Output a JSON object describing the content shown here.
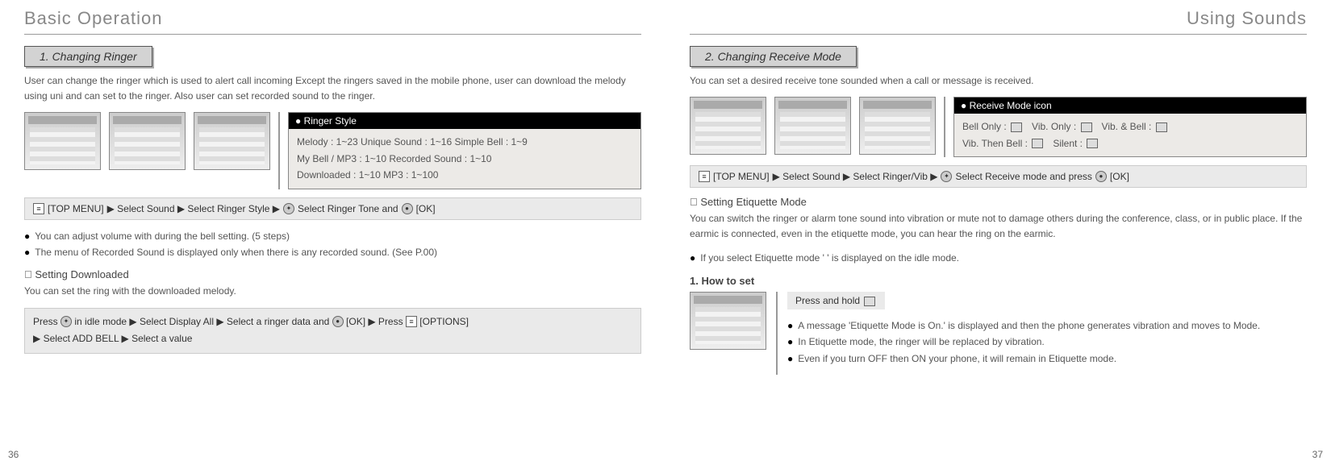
{
  "left": {
    "page_title": "Basic Operation",
    "page_number": "36",
    "section_heading": "1. Changing Ringer",
    "intro": "User can change the ringer which is used to alert call incoming Except the ringers saved in the mobile phone, user can download the melody using uni and can set to the ringer. Also user can set recorded sound to the ringer.",
    "ringer_style_header": "● Ringer Style",
    "ringer_style_lines": [
      "Melody : 1~23   Unique Sound : 1~16   Simple Bell : 1~9",
      "My Bell / MP3 : 1~10   Recorded Sound : 1~10",
      "Downloaded : 1~10    MP3 : 1~100"
    ],
    "nav1_parts": {
      "p1": "[TOP MENU]",
      "p2": "▶ Select Sound ▶ Select Ringer Style ▶",
      "p3": "Select Ringer Tone and",
      "p4": "[OK]"
    },
    "bullets": [
      "You can adjust volume with      during the bell setting. (5 steps)",
      "The menu of Recorded Sound is displayed only when there is any recorded sound. (See P.00)"
    ],
    "sub_heading": "󰚒 Setting Downloaded",
    "sub_text": "You can set the ring with the downloaded melody.",
    "nav2_parts": {
      "p1": "Press",
      "p2": "in idle mode ▶ Select Display All ▶ Select a ringer data and",
      "p3": "[OK] ▶ Press",
      "p4": "[OPTIONS]",
      "p5": "▶ Select ADD BELL ▶ Select a value"
    }
  },
  "right": {
    "page_title": "Using Sounds",
    "page_number": "37",
    "section_heading": "2. Changing Receive Mode",
    "intro": "You can set a desired receive tone sounded when a call or message is received.",
    "receive_header": "● Receive Mode icon",
    "receive_lines": {
      "l1a": "Bell Only :",
      "l1b": "Vib. Only :",
      "l1c": "Vib. & Bell :",
      "l2a": "Vib. Then Bell :",
      "l2b": "Silent :"
    },
    "nav1_parts": {
      "p1": "[TOP MENU]",
      "p2": "▶ Select Sound ▶ Select Ringer/Vib ▶",
      "p3": "Select Receive mode and press",
      "p4": "[OK]"
    },
    "sub_heading": "󰚒 Setting Etiquette Mode",
    "sub_text": "You can switch the ringer or alarm tone sound into vibration or mute not to damage others during the conference, class, or in public place. If the earmic is connected, even in the etiquette mode, you can hear the ring on the earmic.",
    "bullet_after": "If you select Etiquette mode '      ' is displayed on the idle mode.",
    "how_heading": "1. How to set",
    "press_hold": "Press and hold",
    "how_bullets": [
      "A message 'Etiquette Mode is On.' is displayed and then the phone generates vibration and moves to Mode.",
      "In Etiquette mode, the ringer will be replaced by vibration.",
      "Even if you turn OFF then ON your phone, it will remain in Etiquette mode."
    ]
  }
}
